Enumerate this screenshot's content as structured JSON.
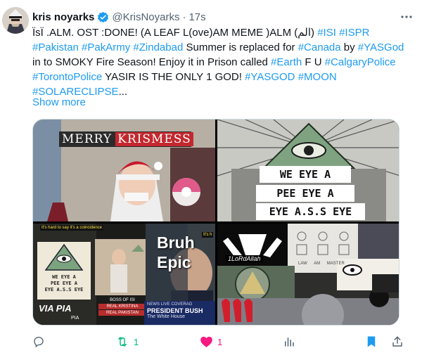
{
  "author": {
    "name": "kris noyarks",
    "handle": "@KrisNoyarks",
    "separator": "·",
    "time": "17s"
  },
  "tweet": {
    "segments": [
      {
        "text": "ÏsÏ .ALM. OST :DONE! (A LEAF L(ove)AM MEME )ALM (الم) ",
        "tag": false
      },
      {
        "text": "#ISI",
        "tag": true
      },
      {
        "text": " ",
        "tag": false
      },
      {
        "text": "#ISPR",
        "tag": true
      },
      {
        "text": " ",
        "tag": false
      },
      {
        "text": "#Pakistan",
        "tag": true
      },
      {
        "text": " ",
        "tag": false
      },
      {
        "text": "#PakArmy",
        "tag": true
      },
      {
        "text": " ",
        "tag": false
      },
      {
        "text": "#Zindabad",
        "tag": true
      },
      {
        "text": " Summer is replaced for ",
        "tag": false
      },
      {
        "text": "#Canada",
        "tag": true
      },
      {
        "text": " by ",
        "tag": false
      },
      {
        "text": "#YASGod",
        "tag": true
      },
      {
        "text": " in to SMOKY Fire Season! Enjoy it in Prison called ",
        "tag": false
      },
      {
        "text": "#Earth",
        "tag": true
      },
      {
        "text": " F U ",
        "tag": false
      },
      {
        "text": "#CalgaryPolice",
        "tag": true
      },
      {
        "text": " ",
        "tag": false
      },
      {
        "text": "#TorontoPolice",
        "tag": true
      },
      {
        "text": " YASIR IS THE ONLY 1 GOD! ",
        "tag": false
      },
      {
        "text": "#YASGOD",
        "tag": true
      },
      {
        "text": " ",
        "tag": false
      },
      {
        "text": "#MOON",
        "tag": true
      },
      {
        "text": " ",
        "tag": false
      },
      {
        "text": "#SOLARECLIPSE",
        "tag": true
      },
      {
        "text": "...",
        "tag": false
      }
    ],
    "show_more": "Show more"
  },
  "media": {
    "image1": {
      "banner_a": "MERRY",
      "banner_b": "KRISMESS"
    },
    "image2": {
      "lines": [
        "WE EYE A",
        "PEE EYE A",
        "EYE A.S.S EYE"
      ]
    },
    "image3": {
      "strip_a": "It's hard to say it's a coincidence",
      "strip_b": "It's h",
      "meme_lines": [
        "WE EYE A",
        "PEE EYE A",
        "EYE A.S.S EYE"
      ],
      "via": "VIA PIA",
      "pia": "PIA",
      "boss": "BOSS OF ISI",
      "kristina_a": "REAL KRISTINA",
      "kristina_b": "REAL PAKISTAN",
      "bruh_a": "Bruh",
      "bruh_b": "Epic",
      "news": "NEWS LIVE COVERAG",
      "president": "PRESIDENT BUSH",
      "whitehouse": "The White House"
    },
    "image4": {
      "lordallah": "1LoRdAllah",
      "law": "LAW",
      "am": "AM",
      "master": "MASTER"
    }
  },
  "actions": {
    "reply_count": "",
    "retweet_count": "1",
    "like_count": "1",
    "views_count": ""
  },
  "colors": {
    "accent": "#1d9bf0",
    "retweet": "#00ba7c",
    "like": "#f91880",
    "muted": "#536471"
  }
}
